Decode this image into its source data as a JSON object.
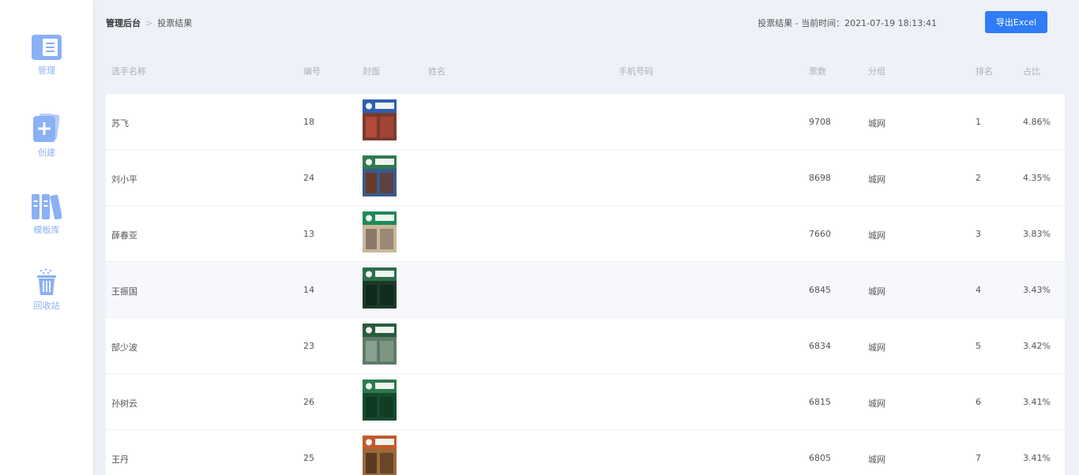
{
  "sidebar": {
    "items": [
      {
        "label": "管理",
        "icon": "document-list-icon"
      },
      {
        "label": "创建",
        "icon": "add-card-icon"
      },
      {
        "label": "模板库",
        "icon": "library-icon"
      },
      {
        "label": "回收站",
        "icon": "trash-icon"
      }
    ]
  },
  "header": {
    "breadcrumb_root": "管理后台",
    "breadcrumb_sep": ">",
    "breadcrumb_current": "投票结果",
    "status_text": "投票结果 - 当前时间：2021-07-19 18:13:41",
    "export_label": "导出Excel"
  },
  "table": {
    "columns": [
      "选手名称",
      "编号",
      "封面",
      "姓名",
      "手机号码",
      "票数",
      "分组",
      "排名",
      "占比"
    ],
    "rows": [
      {
        "name": "苏飞",
        "number": "18",
        "votes": "9708",
        "group": "城网",
        "rank": "1",
        "ratio": "4.86%"
      },
      {
        "name": "刘小平",
        "number": "24",
        "votes": "8698",
        "group": "城网",
        "rank": "2",
        "ratio": "4.35%"
      },
      {
        "name": "薛春亚",
        "number": "13",
        "votes": "7660",
        "group": "城网",
        "rank": "3",
        "ratio": "3.83%"
      },
      {
        "name": "王振国",
        "number": "14",
        "votes": "6845",
        "group": "城网",
        "rank": "4",
        "ratio": "3.43%"
      },
      {
        "name": "郜少波",
        "number": "23",
        "votes": "6834",
        "group": "城网",
        "rank": "5",
        "ratio": "3.42%"
      },
      {
        "name": "孙树云",
        "number": "26",
        "votes": "6815",
        "group": "城网",
        "rank": "6",
        "ratio": "3.41%"
      },
      {
        "name": "王丹",
        "number": "25",
        "votes": "6805",
        "group": "城网",
        "rank": "7",
        "ratio": "3.41%"
      }
    ]
  },
  "colors": {
    "accent": "#2f7cf6",
    "icon": "#8ab0f5",
    "background": "#eef1f8"
  }
}
